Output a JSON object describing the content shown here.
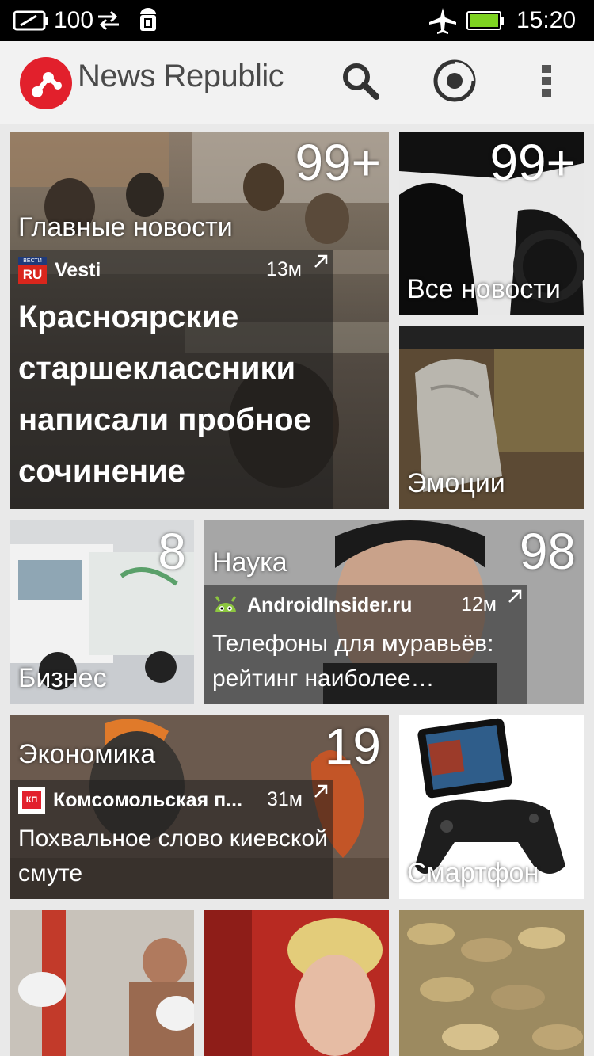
{
  "status_bar": {
    "battery_level": "100",
    "time": "15:20",
    "icons": [
      "battery-icon",
      "sync-arrows-icon",
      "android-debug-icon",
      "airplane-icon",
      "battery-full-icon"
    ]
  },
  "app_bar": {
    "brand_name": "News Republic",
    "actions": [
      "search-icon",
      "refresh-icon",
      "overflow-menu-icon"
    ]
  },
  "tiles": {
    "main": {
      "count": "99+",
      "category": "Главные новости",
      "source": "Vesti",
      "source_badge_top": "ВЕСТИ",
      "source_badge": "RU",
      "time": "13м",
      "headline_lines": [
        "Красноярские",
        "старшеклассники",
        "написали пробное",
        "сочинение"
      ]
    },
    "all_news": {
      "count": "99+",
      "category": "Все новости"
    },
    "emotions": {
      "category": "Эмоции"
    },
    "business": {
      "count": "8",
      "category": "Бизнес"
    },
    "science": {
      "count": "98",
      "category": "Наука",
      "source": "AndroidInsider.ru",
      "time": "12м",
      "headline_lines": [
        "Телефоны для муравьёв:",
        "рейтинг наиболее…"
      ]
    },
    "economy": {
      "count": "19",
      "category": "Экономика",
      "source": "Комсомольская п...",
      "source_badge": "КП",
      "time": "31м",
      "headline_lines": [
        "Похвальное слово киевской",
        "смуте"
      ]
    },
    "smartphone": {
      "category": "Смартфон"
    }
  },
  "colors": {
    "brand_red": "#e2202c",
    "status_bar": "#000000",
    "app_bar": "#f2f2f2",
    "background": "#e9e9e9",
    "android_green": "#8cc63f"
  }
}
